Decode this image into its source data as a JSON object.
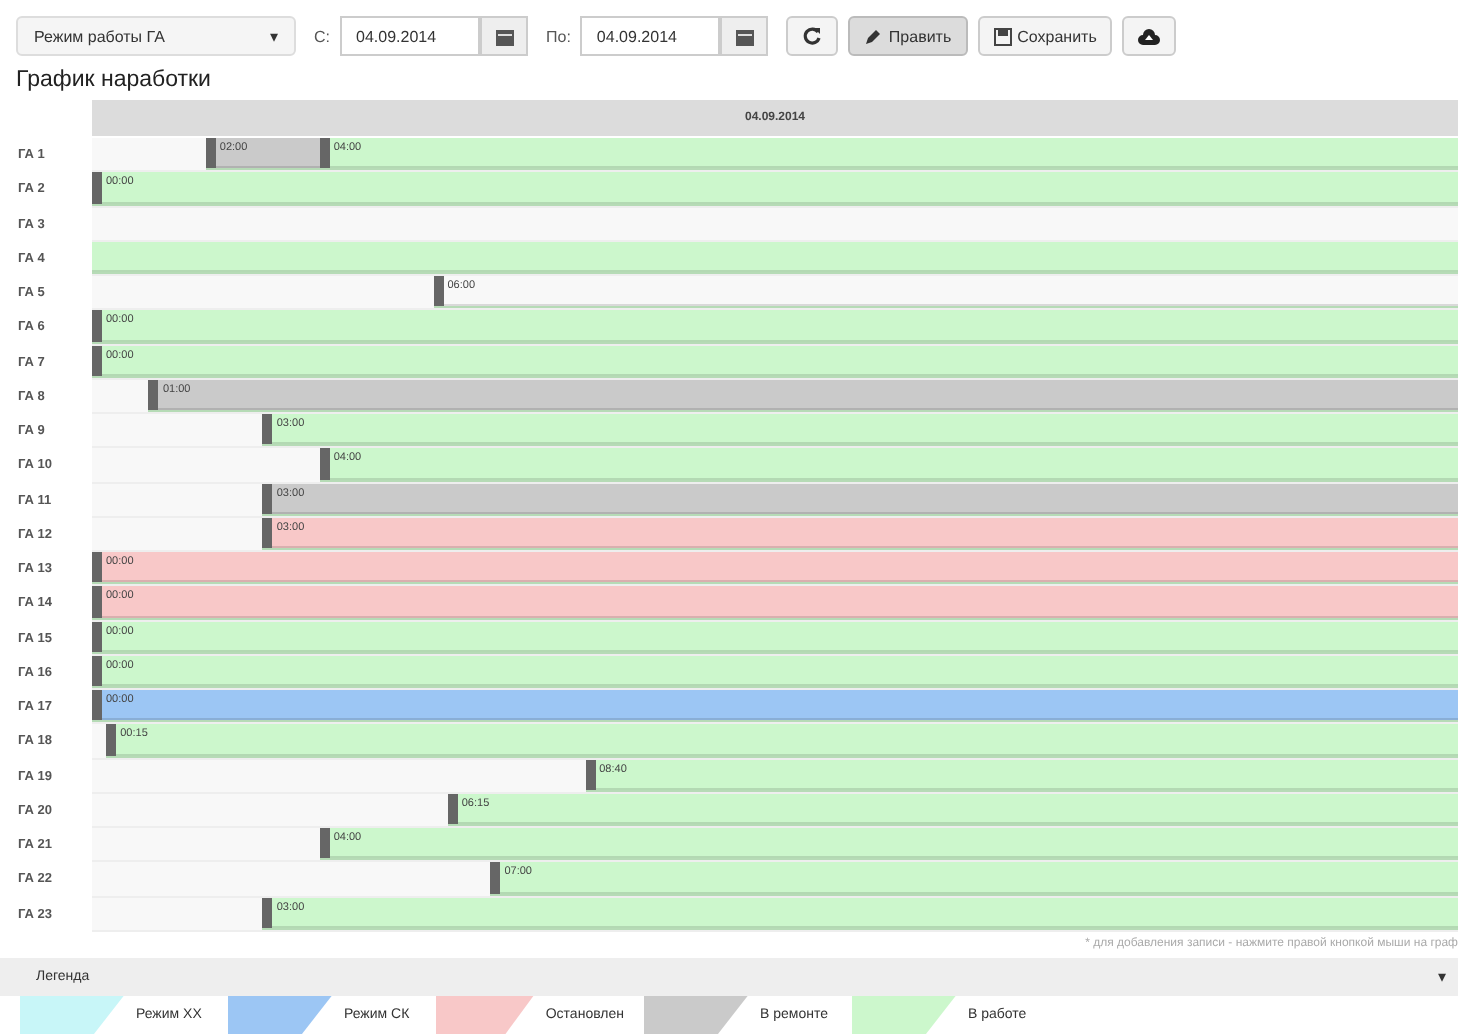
{
  "toolbar": {
    "mode_select": {
      "value": "Режим работы ГА",
      "caret": "▾"
    },
    "from_label": "С:",
    "from_date": "04.09.2014",
    "to_label": "По:",
    "to_date": "04.09.2014",
    "buttons": [
      {
        "kind": "refresh",
        "pressed": false
      },
      {
        "kind": "edit",
        "label": "Править",
        "pressed": true
      },
      {
        "kind": "save",
        "label": "Сохранить",
        "pressed": false
      },
      {
        "kind": "upload",
        "pressed": false
      }
    ]
  },
  "title": "График наработки",
  "timeline": {
    "date": "04.09.2014",
    "rows": [
      {
        "name": "ГА 1",
        "segments": [
          {
            "kind": "repair",
            "time": "02:00"
          },
          {
            "kind": "work",
            "time": "04:00"
          }
        ]
      },
      {
        "name": "ГА 2",
        "segments": [
          {
            "kind": "work",
            "time": "00:00"
          }
        ]
      },
      {
        "name": "ГА 3",
        "segments": []
      },
      {
        "name": "ГА 4",
        "segments": [
          {
            "kind": "work"
          }
        ]
      },
      {
        "name": "ГА 5",
        "segments": [
          {
            "kind": "empty",
            "time": "06:00"
          }
        ]
      },
      {
        "name": "ГА 6",
        "segments": [
          {
            "kind": "work",
            "time": "00:00"
          }
        ]
      },
      {
        "name": "ГА 7",
        "segments": [
          {
            "kind": "work",
            "time": "00:00"
          }
        ]
      },
      {
        "name": "ГА 8",
        "segments": [
          {
            "kind": "repair",
            "time": "01:00"
          }
        ]
      },
      {
        "name": "ГА 9",
        "segments": [
          {
            "kind": "work",
            "time": "03:00"
          }
        ]
      },
      {
        "name": "ГА 10",
        "segments": [
          {
            "kind": "work",
            "time": "04:00"
          }
        ]
      },
      {
        "name": "ГА 11",
        "segments": [
          {
            "kind": "repair",
            "time": "03:00"
          }
        ]
      },
      {
        "name": "ГА 12",
        "segments": [
          {
            "kind": "stopped",
            "time": "03:00"
          }
        ]
      },
      {
        "name": "ГА 13",
        "segments": [
          {
            "kind": "stopped",
            "time": "00:00"
          }
        ]
      },
      {
        "name": "ГА 14",
        "segments": [
          {
            "kind": "stopped",
            "time": "00:00"
          }
        ]
      },
      {
        "name": "ГА 15",
        "segments": [
          {
            "kind": "work",
            "time": "00:00"
          }
        ]
      },
      {
        "name": "ГА 16",
        "segments": [
          {
            "kind": "work",
            "time": "00:00"
          }
        ]
      },
      {
        "name": "ГА 17",
        "segments": [
          {
            "kind": "sk",
            "time": "00:00"
          }
        ]
      },
      {
        "name": "ГА 18",
        "segments": [
          {
            "kind": "work",
            "time": "00:15"
          }
        ]
      },
      {
        "name": "ГА 19",
        "segments": [
          {
            "kind": "work",
            "time": "08:40"
          }
        ]
      },
      {
        "name": "ГА 20",
        "segments": [
          {
            "kind": "work",
            "time": "06:15"
          }
        ]
      },
      {
        "name": "ГА 21",
        "segments": [
          {
            "kind": "work",
            "time": "04:00"
          }
        ]
      },
      {
        "name": "ГА 22",
        "segments": [
          {
            "kind": "work",
            "time": "07:00"
          }
        ]
      },
      {
        "name": "ГА 23",
        "segments": [
          {
            "kind": "work",
            "time": "03:00"
          }
        ]
      }
    ]
  },
  "hint": "* для добавления записи - нажмите правой кнопкой мыши на граф",
  "legend": {
    "title": "Легенда",
    "caret": "▾",
    "items": [
      {
        "kind": "xx",
        "label": "Режим ХХ"
      },
      {
        "kind": "sk",
        "label": "Режим СК"
      },
      {
        "kind": "stopped",
        "label": "Остановлен"
      },
      {
        "kind": "repair",
        "label": "В ремонте"
      },
      {
        "kind": "work",
        "label": "В работе"
      }
    ]
  }
}
